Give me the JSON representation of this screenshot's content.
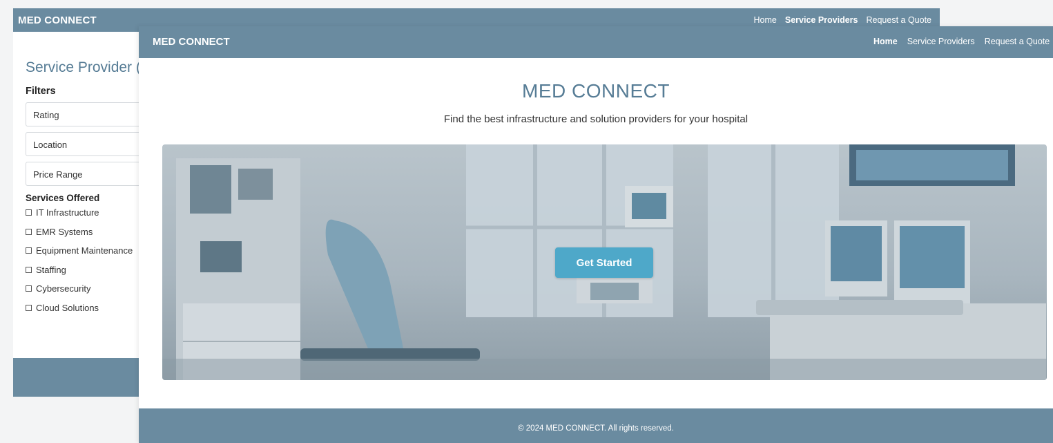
{
  "back_window": {
    "brand": "MED CONNECT",
    "nav": [
      {
        "label": "Home",
        "active": false
      },
      {
        "label": "Service Providers",
        "active": true
      },
      {
        "label": "Request a Quote",
        "active": false
      }
    ],
    "page_title": "Service Provider (",
    "filters_label": "Filters",
    "filters": [
      {
        "label": "Rating"
      },
      {
        "label": "Location"
      },
      {
        "label": "Price Range"
      }
    ],
    "services_label": "Services Offered",
    "services": [
      {
        "label": "IT Infrastructure"
      },
      {
        "label": "EMR Systems"
      },
      {
        "label": "Equipment Maintenance"
      },
      {
        "label": "Staffing"
      },
      {
        "label": "Cybersecurity"
      },
      {
        "label": "Cloud Solutions"
      }
    ]
  },
  "front_window": {
    "brand": "MED CONNECT",
    "nav": [
      {
        "label": "Home",
        "active": true
      },
      {
        "label": "Service Providers",
        "active": false
      },
      {
        "label": "Request a Quote",
        "active": false
      }
    ],
    "hero": {
      "title": "MED CONNECT",
      "subtitle": "Find the best infrastructure and solution providers for your hospital",
      "cta_label": "Get Started"
    },
    "footer": "© 2024 MED CONNECT. All rights reserved."
  },
  "colors": {
    "nav_bg": "#6a8ba0",
    "title": "#567c95",
    "cta": "#4ea8c9"
  }
}
